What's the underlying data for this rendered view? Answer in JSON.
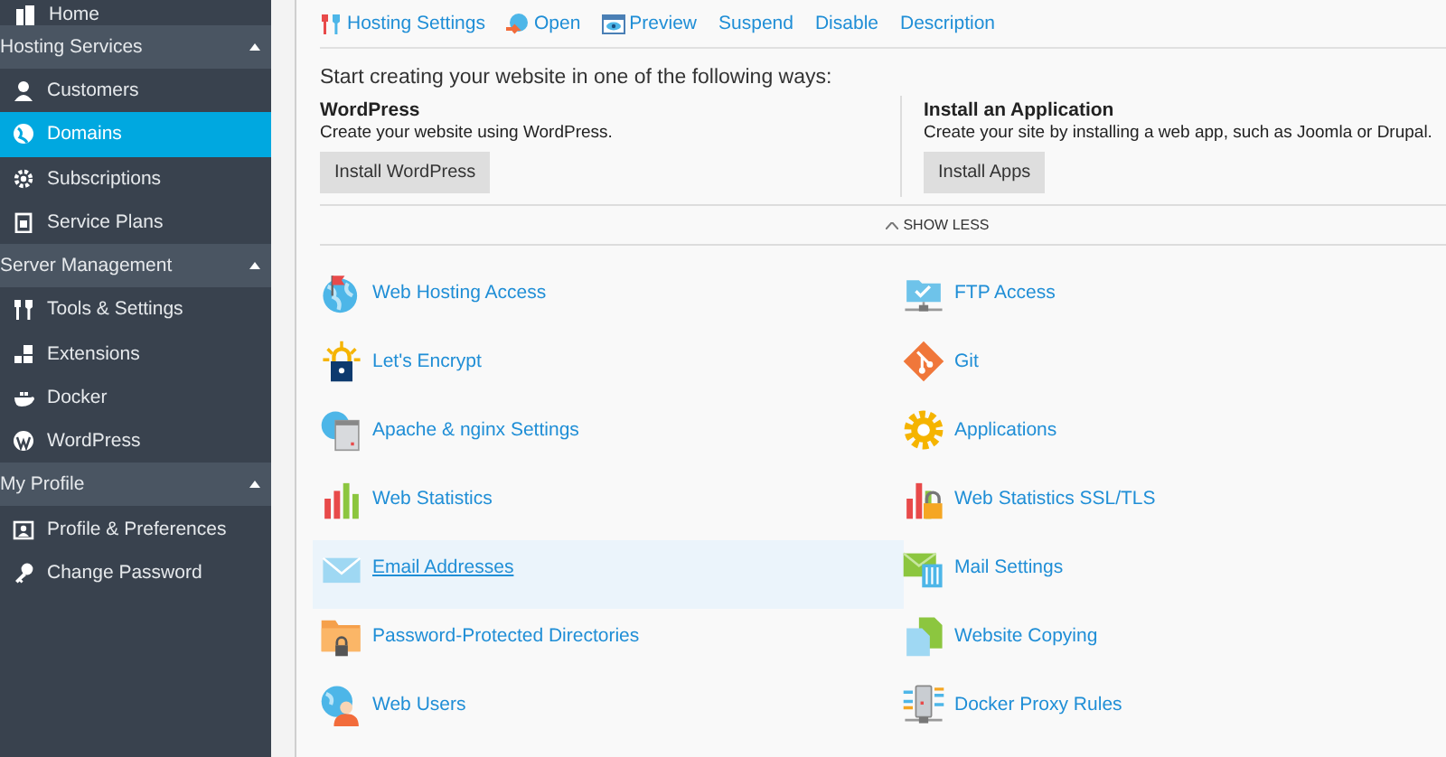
{
  "sidebar": [
    {
      "kind": "item",
      "label": "Home",
      "selected": false
    },
    {
      "kind": "section",
      "label": "Hosting Services",
      "expanded": true,
      "items": [
        {
          "label": "Customers",
          "selected": false
        },
        {
          "label": "Domains",
          "selected": true
        },
        {
          "label": "Subscriptions",
          "selected": false
        },
        {
          "label": "Service Plans",
          "selected": false
        }
      ]
    },
    {
      "kind": "section",
      "label": "Server Management",
      "expanded": true,
      "items": [
        {
          "label": "Tools & Settings",
          "selected": false
        },
        {
          "label": "Extensions",
          "selected": false
        },
        {
          "label": "Docker",
          "selected": false
        },
        {
          "label": "WordPress",
          "selected": false
        }
      ]
    },
    {
      "kind": "section",
      "label": "My Profile",
      "expanded": true,
      "items": [
        {
          "label": "Profile & Preferences",
          "selected": false
        },
        {
          "label": "Change Password",
          "selected": false
        }
      ]
    }
  ],
  "toolbar": [
    "Hosting Settings",
    "Open",
    "Preview",
    "Suspend",
    "Disable",
    "Description"
  ],
  "create_website": {
    "intro": "Start creating your website in one of the following ways:",
    "options": [
      {
        "title": "WordPress",
        "description": "Create your website using WordPress.",
        "button": "Install WordPress"
      },
      {
        "title": "Install an Application",
        "description": "Create your site by installing a web app, such as Joomla or Drupal.",
        "button": "Install Apps"
      }
    ]
  },
  "toggle": {
    "label": "SHOW LESS",
    "expanded": true
  },
  "tools": [
    {
      "label": "Web Hosting Access",
      "highlighted": false
    },
    {
      "label": "FTP Access",
      "highlighted": false
    },
    {
      "label": "Let's Encrypt",
      "highlighted": false
    },
    {
      "label": "Git",
      "highlighted": false
    },
    {
      "label": "Apache & nginx Settings",
      "highlighted": false
    },
    {
      "label": "Applications",
      "highlighted": false
    },
    {
      "label": "Web Statistics",
      "highlighted": false
    },
    {
      "label": "Web Statistics SSL/TLS",
      "highlighted": false
    },
    {
      "label": "Email Addresses",
      "highlighted": true
    },
    {
      "label": "Mail Settings",
      "highlighted": false
    },
    {
      "label": "Password-Protected Directories",
      "highlighted": false
    },
    {
      "label": "Website Copying",
      "highlighted": false
    },
    {
      "label": "Web Users",
      "highlighted": false
    },
    {
      "label": "Docker Proxy Rules",
      "highlighted": false
    }
  ]
}
